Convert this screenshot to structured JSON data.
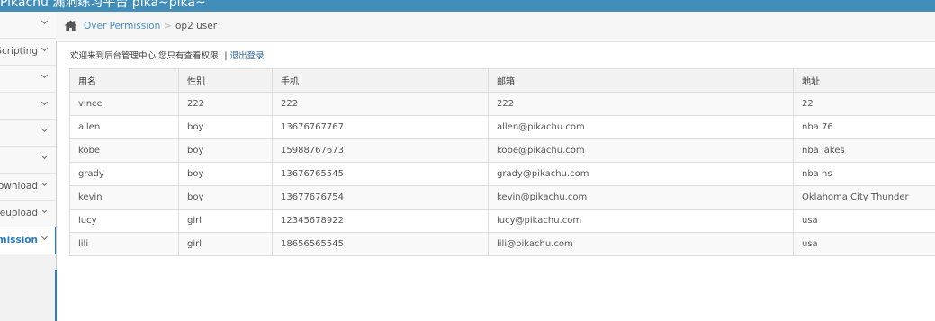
{
  "app": {
    "title": "Pikachu 漏洞练习平台 pika~pika~"
  },
  "sidebar": {
    "items": [
      {
        "label": ""
      },
      {
        "label": "Cross-Site Scripting"
      },
      {
        "label": ""
      },
      {
        "label": ""
      },
      {
        "label": ""
      },
      {
        "label": ""
      },
      {
        "label": "Unsafe Filedownload"
      },
      {
        "label": "Unsafe Fileupload"
      },
      {
        "label": "Over Permission"
      }
    ]
  },
  "breadcrumb": {
    "parent": "Over Permission",
    "separator": ">",
    "current": "op2 user"
  },
  "welcome": {
    "text": "欢迎来到后台管理中心,您只有查看权限! | ",
    "logout_label": "退出登录"
  },
  "table": {
    "headers": [
      "用名",
      "性别",
      "手机",
      "邮箱",
      "地址"
    ],
    "rows": [
      [
        "vince",
        "222",
        "222",
        "222",
        "22"
      ],
      [
        "allen",
        "boy",
        "13676767767",
        "allen@pikachu.com",
        "nba 76"
      ],
      [
        "kobe",
        "boy",
        "15988767673",
        "kobe@pikachu.com",
        "nba lakes"
      ],
      [
        "grady",
        "boy",
        "13676765545",
        "grady@pikachu.com",
        "nba hs"
      ],
      [
        "kevin",
        "boy",
        "13677676754",
        "kevin@pikachu.com",
        "Oklahoma City Thunder"
      ],
      [
        "lucy",
        "girl",
        "12345678922",
        "lucy@pikachu.com",
        "usa"
      ],
      [
        "lili",
        "girl",
        "18656565545",
        "lili@pikachu.com",
        "usa"
      ]
    ]
  },
  "colors": {
    "topbar": "#438eb9",
    "link": "#2a6496",
    "accent": "#2b7dbc"
  },
  "icons": {
    "home": "home-icon",
    "chevron": "chevron-down-icon"
  }
}
